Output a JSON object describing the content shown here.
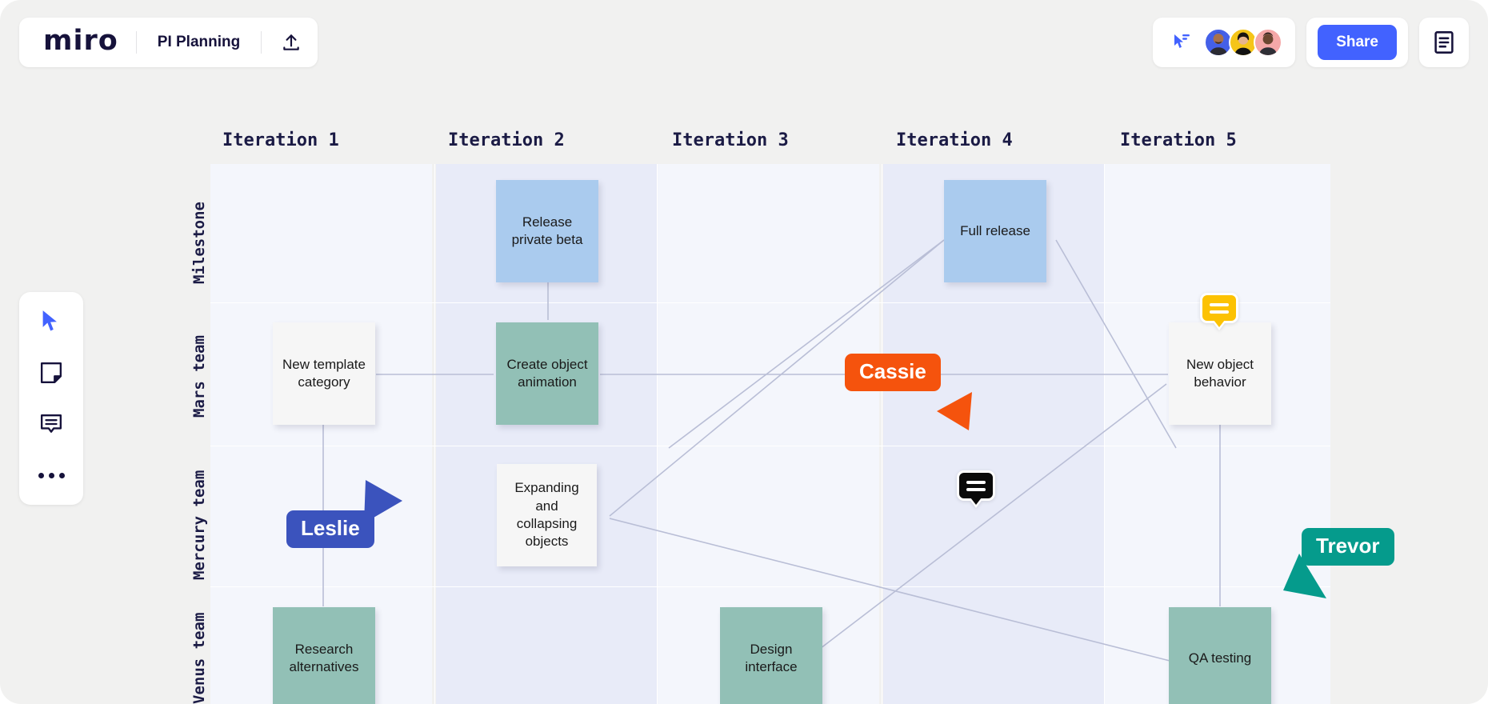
{
  "header": {
    "logo_text": "miro",
    "board_title": "PI Planning",
    "upload_icon": "upload-icon",
    "cursor_chat_icon": "cursor-chat-icon",
    "share_label": "Share",
    "notes_icon": "board-notes-icon",
    "avatars": [
      {
        "name": "collaborator-avatar-1",
        "color": "#4460e8"
      },
      {
        "name": "collaborator-avatar-2",
        "color": "#f5c518"
      },
      {
        "name": "collaborator-avatar-3",
        "color": "#f5a8a8"
      }
    ]
  },
  "toolbar": {
    "items": [
      {
        "name": "select-tool",
        "icon": "cursor-icon",
        "active": true
      },
      {
        "name": "sticky-tool",
        "icon": "sticky-note-icon",
        "active": false
      },
      {
        "name": "comment-tool",
        "icon": "comment-icon",
        "active": false
      },
      {
        "name": "more-tool",
        "icon": "more-dots-icon",
        "active": false
      }
    ]
  },
  "board": {
    "columns": [
      {
        "label": "Iteration 1"
      },
      {
        "label": "Iteration 2"
      },
      {
        "label": "Iteration 3"
      },
      {
        "label": "Iteration 4"
      },
      {
        "label": "Iteration 5"
      }
    ],
    "rows": [
      {
        "label": "Milestone"
      },
      {
        "label": "Mars team"
      },
      {
        "label": "Mercury team"
      },
      {
        "label": "Venus team"
      }
    ],
    "notes": [
      {
        "id": "n1",
        "text": "Release private beta",
        "color": "blue",
        "row": "Milestone",
        "column": "Iteration 2"
      },
      {
        "id": "n2",
        "text": "Full release",
        "color": "blue",
        "row": "Milestone",
        "column": "Iteration 4"
      },
      {
        "id": "n3",
        "text": "New template category",
        "color": "white",
        "row": "Mars team",
        "column": "Iteration 1"
      },
      {
        "id": "n4",
        "text": "Create object animation",
        "color": "green",
        "row": "Mars team",
        "column": "Iteration 2"
      },
      {
        "id": "n5",
        "text": "New object behavior",
        "color": "white",
        "row": "Mars team",
        "column": "Iteration 5"
      },
      {
        "id": "n6",
        "text": "Expanding and collapsing objects",
        "color": "white",
        "row": "Mercury team",
        "column": "Iteration 2"
      },
      {
        "id": "n7",
        "text": "Research alternatives",
        "color": "green",
        "row": "Venus team",
        "column": "Iteration 1"
      },
      {
        "id": "n8",
        "text": "Design interface",
        "color": "green",
        "row": "Venus team",
        "column": "Iteration 3"
      },
      {
        "id": "n9",
        "text": "QA testing",
        "color": "green",
        "row": "Venus team",
        "column": "Iteration 5"
      }
    ],
    "comments": [
      {
        "id": "c1",
        "style": "yellow",
        "attached_to": "New object behavior"
      },
      {
        "id": "c2",
        "style": "dark",
        "attached_to": "Iteration 4 / Mercury team"
      }
    ],
    "cursors": [
      {
        "name": "Cassie",
        "color": "#f5530d"
      },
      {
        "name": "Leslie",
        "color": "#3b53bd"
      },
      {
        "name": "Trevor",
        "color": "#059b8c"
      }
    ]
  }
}
